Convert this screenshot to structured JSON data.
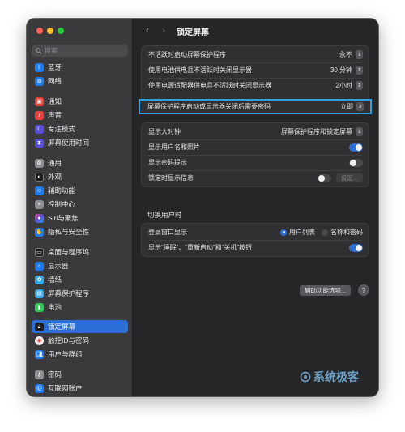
{
  "sidebar": {
    "search_placeholder": "搜索",
    "items": [
      {
        "label": "蓝牙",
        "icon": "bluetooth-icon",
        "color": "#1e7cf2"
      },
      {
        "label": "网络",
        "icon": "network-globe-icon",
        "color": "#1e7cf2"
      },
      {
        "label": "通知",
        "icon": "notifications-icon",
        "color": "#e8413a"
      },
      {
        "label": "声音",
        "icon": "sound-speaker-icon",
        "color": "#e8413a"
      },
      {
        "label": "专注模式",
        "icon": "focus-moon-icon",
        "color": "#5a4fd6"
      },
      {
        "label": "屏幕使用时间",
        "icon": "screen-time-hourglass-icon",
        "color": "#5a4fd6"
      },
      {
        "label": "通用",
        "icon": "general-gear-icon",
        "color": "#8e8e93"
      },
      {
        "label": "外观",
        "icon": "appearance-icon",
        "color": "#1c1c1e"
      },
      {
        "label": "辅助功能",
        "icon": "accessibility-icon",
        "color": "#1e7cf2"
      },
      {
        "label": "控制中心",
        "icon": "control-center-icon",
        "color": "#8e8e93"
      },
      {
        "label": "Siri与聚焦",
        "icon": "siri-icon",
        "color": "#9b4fd6"
      },
      {
        "label": "隐私与安全性",
        "icon": "privacy-hand-icon",
        "color": "#1e7cf2"
      },
      {
        "label": "桌面与程序坞",
        "icon": "desktop-dock-icon",
        "color": "#1c1c1e"
      },
      {
        "label": "显示器",
        "icon": "displays-sun-icon",
        "color": "#1e7cf2"
      },
      {
        "label": "墙纸",
        "icon": "wallpaper-flower-icon",
        "color": "#38a9e8"
      },
      {
        "label": "屏幕保护程序",
        "icon": "screensaver-icon",
        "color": "#38a9e8"
      },
      {
        "label": "电池",
        "icon": "battery-icon",
        "color": "#34c759"
      },
      {
        "label": "锁定屏幕",
        "icon": "lock-screen-icon",
        "color": "#1c1c1e"
      },
      {
        "label": "触控ID与密码",
        "icon": "touch-id-fingerprint-icon",
        "color": "#f2f2f2"
      },
      {
        "label": "用户与群组",
        "icon": "users-groups-icon",
        "color": "#1e7cf2"
      },
      {
        "label": "密码",
        "icon": "passwords-key-icon",
        "color": "#8e8e93"
      },
      {
        "label": "互联网账户",
        "icon": "internet-accounts-at-icon",
        "color": "#1e7cf2"
      }
    ]
  },
  "main": {
    "title": "锁定屏幕",
    "group1": [
      {
        "label": "不活跃时启动屏幕保护程序",
        "value": "永不"
      },
      {
        "label": "使用电池供电且不活跃时关闭显示器",
        "value": "30 分钟"
      },
      {
        "label": "使用电源适配器供电且不活跃时关闭显示器",
        "value": "2小时"
      },
      {
        "label": "屏幕保护程序启动或显示器关闭后需要密码",
        "value": "立即"
      }
    ],
    "group2": {
      "clock_label": "显示大时钟",
      "clock_value": "屏幕保护程序和锁定屏幕",
      "show_user_label": "显示用户名和照片",
      "show_user_on": true,
      "password_hint_label": "显示密码提示",
      "password_hint_on": false,
      "lock_message_label": "锁定时显示信息",
      "lock_message_on": false,
      "lock_message_button": "设定..."
    },
    "switch_user": {
      "heading": "切换用户时",
      "login_window_label": "登录窗口显示",
      "option_list": "用户列表",
      "option_name_password": "名称和密码",
      "selected": "用户列表",
      "show_buttons_label": "显示“睡眠”、“重新启动”和“关机”按钮",
      "show_buttons_on": true
    },
    "accessibility_button": "辅助功能选项...",
    "help_button": "?",
    "watermark": "系统极客"
  },
  "colors": {
    "accent": "#2b6fd6",
    "highlight_border": "#2ea2e0"
  }
}
